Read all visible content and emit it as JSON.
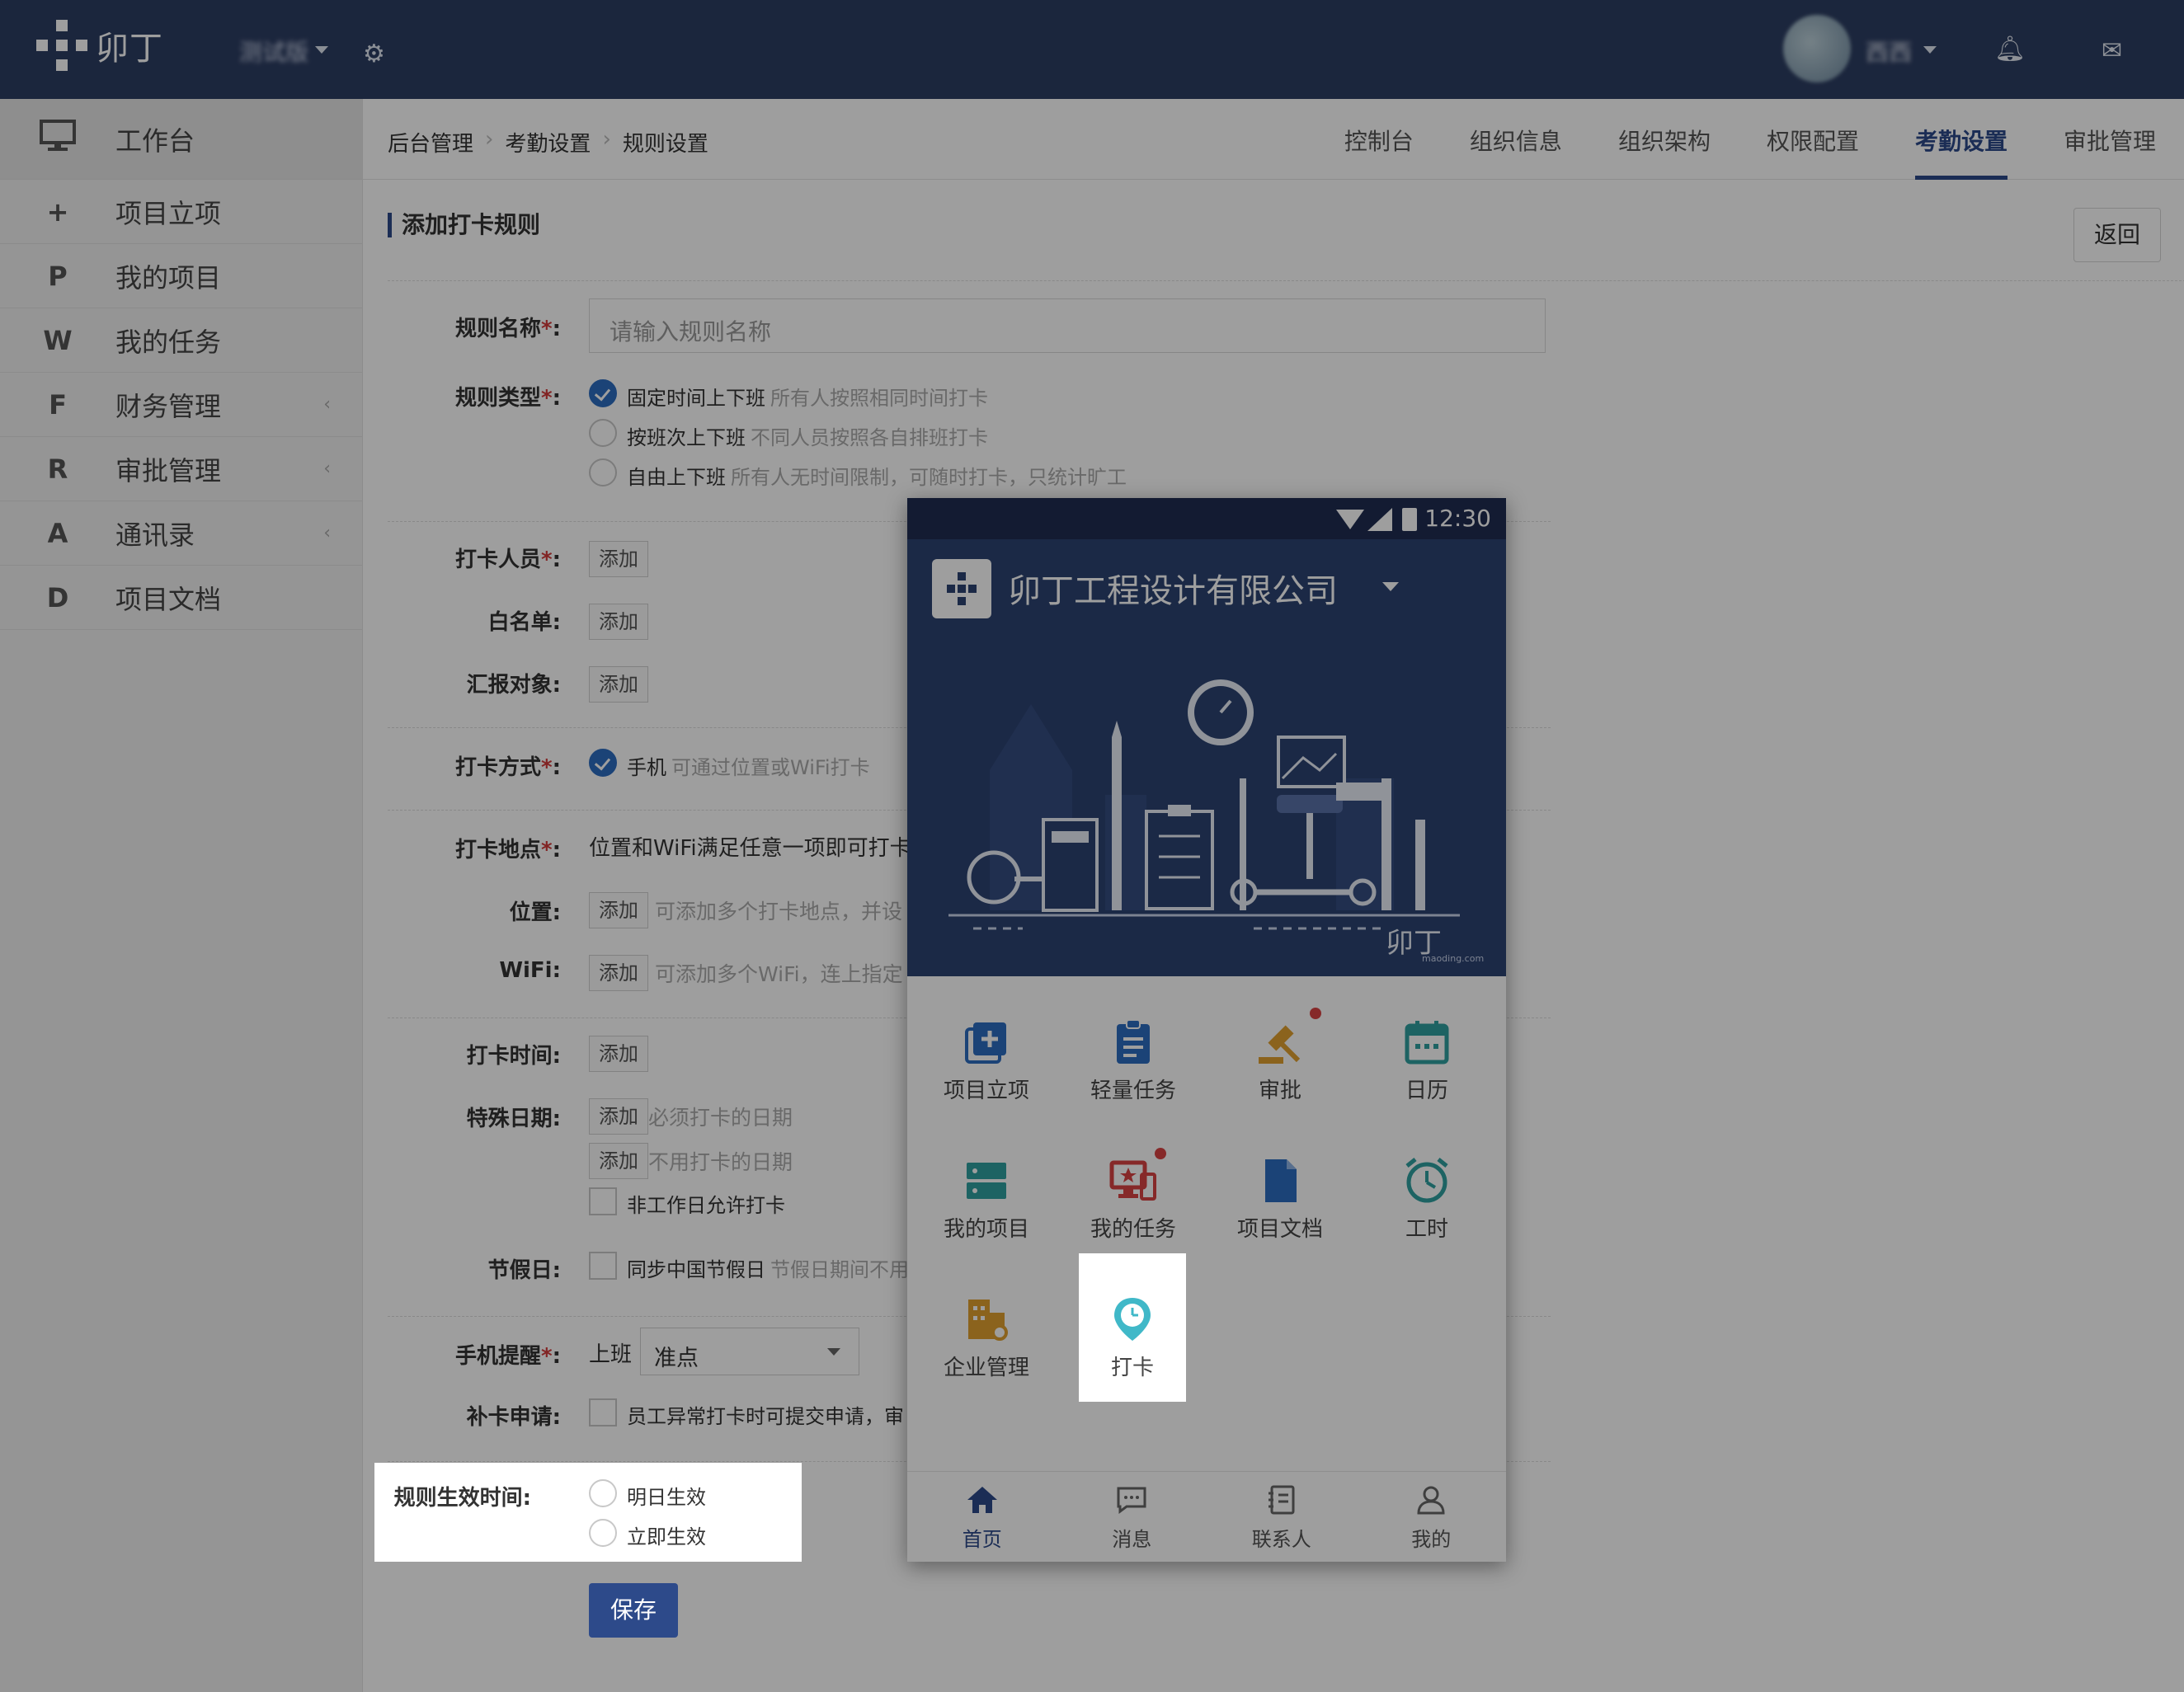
{
  "app": {
    "brand": "卯丁",
    "org_name": "测试版",
    "user_name": "西西"
  },
  "sidebar": {
    "items": [
      {
        "icon": "monitor",
        "label": "工作台"
      },
      {
        "icon": "+",
        "label": "项目立项"
      },
      {
        "icon": "P",
        "label": "我的项目"
      },
      {
        "icon": "W",
        "label": "我的任务"
      },
      {
        "icon": "F",
        "label": "财务管理",
        "chevron": "‹"
      },
      {
        "icon": "R",
        "label": "审批管理",
        "chevron": "‹"
      },
      {
        "icon": "A",
        "label": "通讯录",
        "chevron": "‹"
      },
      {
        "icon": "D",
        "label": "项目文档"
      }
    ]
  },
  "breadcrumb": [
    "后台管理",
    "考勤设置",
    "规则设置"
  ],
  "breadcrumb_sep": "›",
  "tabs": [
    {
      "label": "控制台",
      "active": false
    },
    {
      "label": "组织信息",
      "active": false
    },
    {
      "label": "组织架构",
      "active": false
    },
    {
      "label": "权限配置",
      "active": false
    },
    {
      "label": "考勤设置",
      "active": true
    },
    {
      "label": "审批管理",
      "active": false
    }
  ],
  "form": {
    "section_title": "添加打卡规则",
    "back_label": "返回",
    "rule_name": {
      "label": "规则名称",
      "req": "*",
      "colon": ":",
      "placeholder": "请输入规则名称"
    },
    "rule_type": {
      "label": "规则类型",
      "req": "*",
      "colon": ":",
      "options": [
        {
          "label": "固定时间上下班",
          "hint": "所有人按照相同时间打卡",
          "checked": true
        },
        {
          "label": "按班次上下班",
          "hint": "不同人员按照各自排班打卡",
          "checked": false
        },
        {
          "label": "自由上下班",
          "hint": "所有人无时间限制，可随时打卡，只统计旷工",
          "checked": false
        }
      ]
    },
    "add_label": "添加",
    "clock_people": {
      "label": "打卡人员",
      "req": "*",
      "colon": ":"
    },
    "whitelist": {
      "label": "白名单:"
    },
    "report_to": {
      "label": "汇报对象:"
    },
    "clock_method": {
      "label": "打卡方式",
      "req": "*",
      "colon": ":",
      "option": "手机",
      "hint": "可通过位置或WiFi打卡"
    },
    "clock_place": {
      "label": "打卡地点",
      "req": "*",
      "colon": ":",
      "text": "位置和WiFi满足任意一项即可打卡"
    },
    "location": {
      "label": "位置:",
      "hint": "可添加多个打卡地点，并设"
    },
    "wifi": {
      "label": "WiFi:",
      "hint": "可添加多个WiFi，连上指定"
    },
    "clock_time": {
      "label": "打卡时间:"
    },
    "special_dates": {
      "label": "特殊日期:",
      "hint1": "必须打卡的日期",
      "hint2": "不用打卡的日期",
      "check_label": "非工作日允许打卡"
    },
    "holidays": {
      "label": "节假日:",
      "check_label": "同步中国节假日",
      "hint": "节假日期间不用"
    },
    "phone_remind": {
      "label": "手机提醒",
      "req": "*",
      "colon": ":",
      "prefix": "上班",
      "value": "准点"
    },
    "makeup": {
      "label": "补卡申请:",
      "check_label": "员工异常打卡时可提交申请，审"
    },
    "effective": {
      "label": "规则生效时间:",
      "options": [
        "明日生效",
        "立即生效"
      ]
    },
    "save_label": "保存"
  },
  "phone": {
    "time": "12:30",
    "company": "卯丁工程设计有限公司",
    "banner_brand": "卯丁",
    "banner_site": "maoding.com",
    "apps": [
      {
        "icon": "add-project-icon",
        "label": "项目立项",
        "color": "#2d6cc0"
      },
      {
        "icon": "clipboard-icon",
        "label": "轻量任务",
        "color": "#2d6cc0"
      },
      {
        "icon": "gavel-icon",
        "label": "审批",
        "color": "#e0a030",
        "badge": true
      },
      {
        "icon": "calendar-icon",
        "label": "日历",
        "color": "#30a0a0"
      },
      {
        "icon": "server-icon",
        "label": "我的项目",
        "color": "#30a0a0"
      },
      {
        "icon": "monitor-task-icon",
        "label": "我的任务",
        "color": "#d94343",
        "badge": true
      },
      {
        "icon": "file-icon",
        "label": "项目文档",
        "color": "#2d6cc0"
      },
      {
        "icon": "alarm-icon",
        "label": "工时",
        "color": "#30a0a0"
      },
      {
        "icon": "building-icon",
        "label": "企业管理",
        "color": "#e0a030"
      },
      {
        "icon": "location-clock-icon",
        "label": "打卡",
        "color": "#40b8c8"
      }
    ],
    "bottom_nav": [
      {
        "icon": "home-icon",
        "label": "首页",
        "active": true
      },
      {
        "icon": "chat-icon",
        "label": "消息",
        "active": false
      },
      {
        "icon": "contacts-icon",
        "label": "联系人",
        "active": false
      },
      {
        "icon": "user-icon",
        "label": "我的",
        "active": false
      }
    ]
  }
}
